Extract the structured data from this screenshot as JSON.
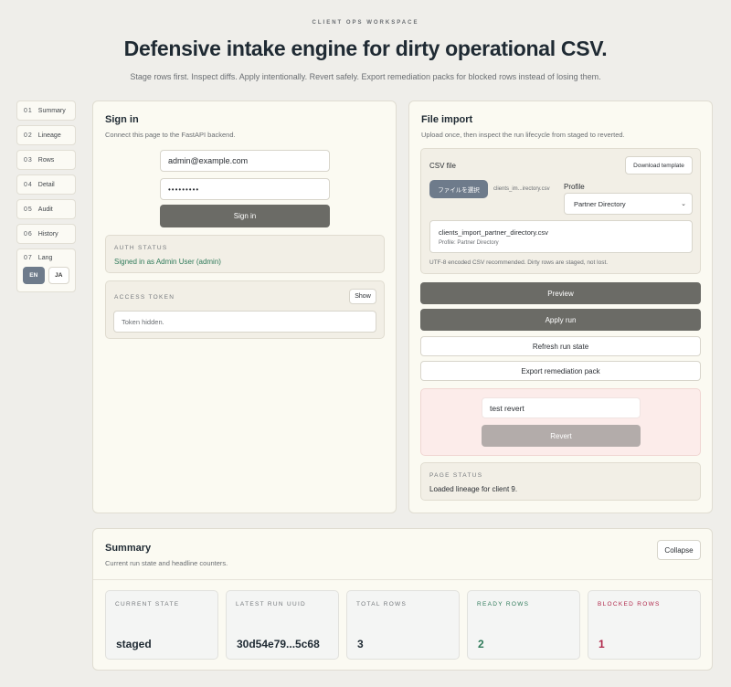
{
  "header": {
    "eyebrow": "CLIENT OPS WORKSPACE",
    "title": "Defensive intake engine for dirty operational CSV.",
    "subtitle": "Stage rows first. Inspect diffs. Apply intentionally. Revert safely. Export remediation packs for blocked rows instead of losing them."
  },
  "nav": {
    "items": [
      {
        "num": "01",
        "label": "Summary"
      },
      {
        "num": "02",
        "label": "Lineage"
      },
      {
        "num": "03",
        "label": "Rows"
      },
      {
        "num": "04",
        "label": "Detail"
      },
      {
        "num": "05",
        "label": "Audit"
      },
      {
        "num": "06",
        "label": "History"
      }
    ],
    "lang": {
      "num": "07",
      "label": "Lang",
      "en": "EN",
      "ja": "JA"
    }
  },
  "signin": {
    "title": "Sign in",
    "subtitle": "Connect this page to the FastAPI backend.",
    "email_value": "admin@example.com",
    "password_value": "•••••••••",
    "button": "Sign in",
    "auth_label": "AUTH STATUS",
    "auth_value": "Signed in as Admin User (admin)",
    "token_label": "ACCESS TOKEN",
    "token_show": "Show",
    "token_value": "Token hidden."
  },
  "import": {
    "title": "File import",
    "subtitle": "Upload once, then inspect the run lifecycle from staged to reverted.",
    "csv_label": "CSV file",
    "download_template": "Download template",
    "choose_file": "ファイルを選択",
    "file_name_short": "clients_im...irectory.csv",
    "profile_label": "Profile",
    "profile_selected": "Partner Directory",
    "file_full": "clients_import_partner_directory.csv",
    "file_profile": "Profile: Partner Directory",
    "hint": "UTF-8 encoded CSV recommended. Dirty rows are staged, not lost.",
    "preview": "Preview",
    "apply": "Apply run",
    "refresh": "Refresh run state",
    "export": "Export remediation pack",
    "revert_reason": "test revert",
    "revert": "Revert",
    "page_status_label": "PAGE STATUS",
    "page_status_value": "Loaded lineage for client 9."
  },
  "summary": {
    "title": "Summary",
    "subtitle": "Current run state and headline counters.",
    "collapse": "Collapse",
    "stats": [
      {
        "label": "CURRENT STATE",
        "value": "staged"
      },
      {
        "label": "LATEST RUN UUID",
        "value": "30d54e79...5c68"
      },
      {
        "label": "TOTAL ROWS",
        "value": "3"
      },
      {
        "label": "READY ROWS",
        "value": "2"
      },
      {
        "label": "BLOCKED ROWS",
        "value": "1"
      }
    ]
  },
  "colors": {
    "accent_green": "#2f7a5a",
    "accent_red": "#b0284a",
    "dark_button": "#6b6b66",
    "revert_bg": "#fcecea",
    "revert_button": "#b3acaa"
  }
}
